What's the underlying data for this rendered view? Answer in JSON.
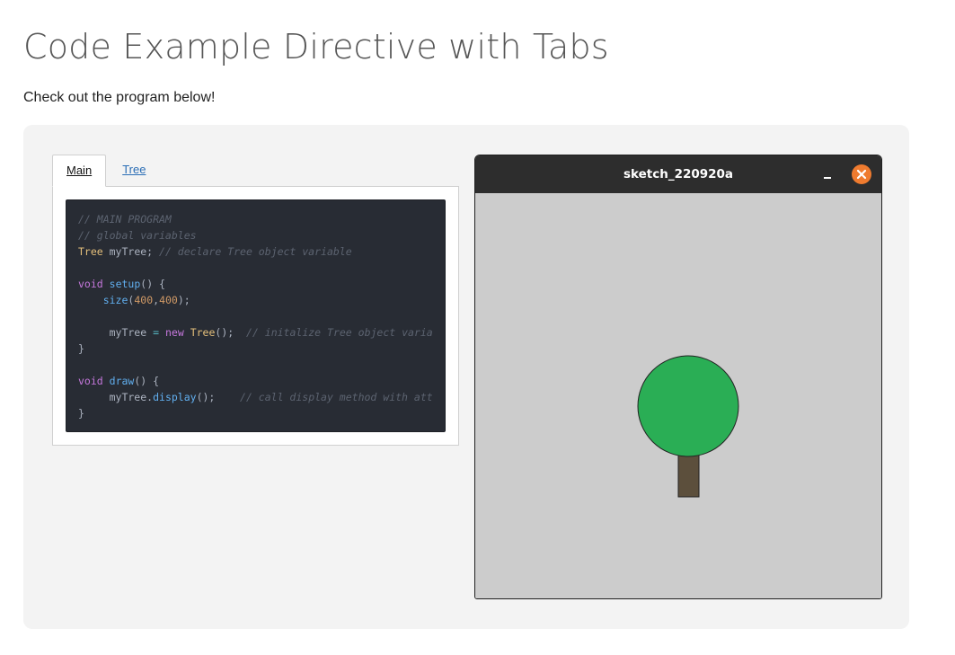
{
  "page": {
    "title": "Code Example Directive with Tabs",
    "intro": "Check out the program below!"
  },
  "tabs": [
    {
      "label": "Main",
      "active": true
    },
    {
      "label": "Tree",
      "active": false
    }
  ],
  "code": {
    "language": "processing",
    "lines": [
      [
        [
          "c-com",
          "// MAIN PROGRAM"
        ]
      ],
      [
        [
          "c-com",
          "// global variables"
        ]
      ],
      [
        [
          "c-type",
          "Tree"
        ],
        [
          "c-plain",
          " myTree; "
        ],
        [
          "c-com",
          "// declare Tree object variable"
        ]
      ],
      [],
      [
        [
          "c-kw",
          "void"
        ],
        [
          "c-plain",
          " "
        ],
        [
          "c-fn",
          "setup"
        ],
        [
          "c-plain",
          "() {"
        ]
      ],
      [
        [
          "c-plain",
          "    "
        ],
        [
          "c-fn",
          "size"
        ],
        [
          "c-plain",
          "("
        ],
        [
          "c-num",
          "400"
        ],
        [
          "c-plain",
          ","
        ],
        [
          "c-num",
          "400"
        ],
        [
          "c-plain",
          ");"
        ]
      ],
      [],
      [
        [
          "c-plain",
          "     myTree "
        ],
        [
          "c-op",
          "="
        ],
        [
          "c-plain",
          " "
        ],
        [
          "c-kw",
          "new"
        ],
        [
          "c-plain",
          " "
        ],
        [
          "c-type",
          "Tree"
        ],
        [
          "c-plain",
          "();  "
        ],
        [
          "c-com",
          "// initalize Tree object varia"
        ]
      ],
      [
        [
          "c-plain",
          "}"
        ]
      ],
      [],
      [
        [
          "c-kw",
          "void"
        ],
        [
          "c-plain",
          " "
        ],
        [
          "c-fn",
          "draw"
        ],
        [
          "c-plain",
          "() {"
        ]
      ],
      [
        [
          "c-plain",
          "     myTree."
        ],
        [
          "c-fn",
          "display"
        ],
        [
          "c-plain",
          "();    "
        ],
        [
          "c-com",
          "// call display method with att"
        ]
      ],
      [
        [
          "c-plain",
          "}"
        ]
      ]
    ]
  },
  "sketch_window": {
    "title": "sketch_220920a",
    "minimize_icon": "minimize-icon",
    "close_icon": "close-icon",
    "colors": {
      "titlebar": "#2d2d2d",
      "canvas": "#cccccc",
      "close": "#ef7b2f",
      "foliage": "#2aae55",
      "trunk": "#5c4f3c"
    }
  }
}
